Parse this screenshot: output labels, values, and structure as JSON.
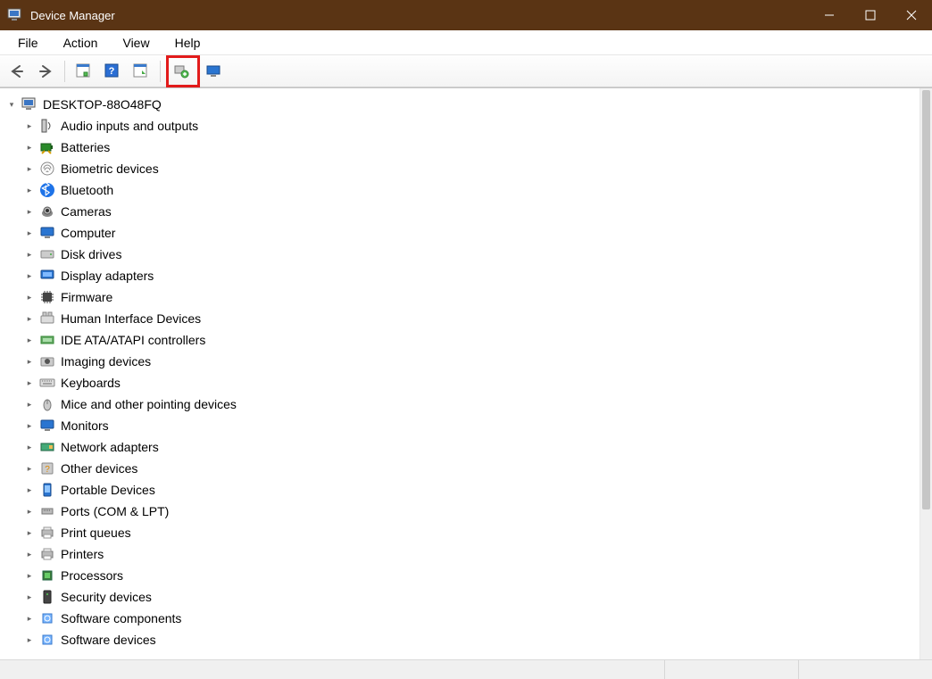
{
  "window": {
    "title": "Device Manager"
  },
  "menu": {
    "file": "File",
    "action": "Action",
    "view": "View",
    "help": "Help"
  },
  "toolbar": {
    "back": "Back",
    "forward": "Forward",
    "show_hide_tree": "Show/Hide Console Tree",
    "help_btn": "Help",
    "action_menu": "Action Menu",
    "scan": "Scan for hardware changes",
    "add_legacy": "Add legacy hardware"
  },
  "tree": {
    "root": "DESKTOP-88O48FQ",
    "items": [
      {
        "label": "Audio inputs and outputs",
        "icon": "speaker"
      },
      {
        "label": "Batteries",
        "icon": "battery"
      },
      {
        "label": "Biometric devices",
        "icon": "fingerprint"
      },
      {
        "label": "Bluetooth",
        "icon": "bluetooth"
      },
      {
        "label": "Cameras",
        "icon": "camera"
      },
      {
        "label": "Computer",
        "icon": "monitor"
      },
      {
        "label": "Disk drives",
        "icon": "disk"
      },
      {
        "label": "Display adapters",
        "icon": "display"
      },
      {
        "label": "Firmware",
        "icon": "chip"
      },
      {
        "label": "Human Interface Devices",
        "icon": "hid"
      },
      {
        "label": "IDE ATA/ATAPI controllers",
        "icon": "ide"
      },
      {
        "label": "Imaging devices",
        "icon": "camera2"
      },
      {
        "label": "Keyboards",
        "icon": "keyboard"
      },
      {
        "label": "Mice and other pointing devices",
        "icon": "mouse"
      },
      {
        "label": "Monitors",
        "icon": "monitor"
      },
      {
        "label": "Network adapters",
        "icon": "netadapter"
      },
      {
        "label": "Other devices",
        "icon": "unknown"
      },
      {
        "label": "Portable Devices",
        "icon": "portable"
      },
      {
        "label": "Ports (COM & LPT)",
        "icon": "port"
      },
      {
        "label": "Print queues",
        "icon": "printer"
      },
      {
        "label": "Printers",
        "icon": "printer"
      },
      {
        "label": "Processors",
        "icon": "cpu"
      },
      {
        "label": "Security devices",
        "icon": "security"
      },
      {
        "label": "Software components",
        "icon": "software"
      },
      {
        "label": "Software devices",
        "icon": "software"
      }
    ]
  }
}
